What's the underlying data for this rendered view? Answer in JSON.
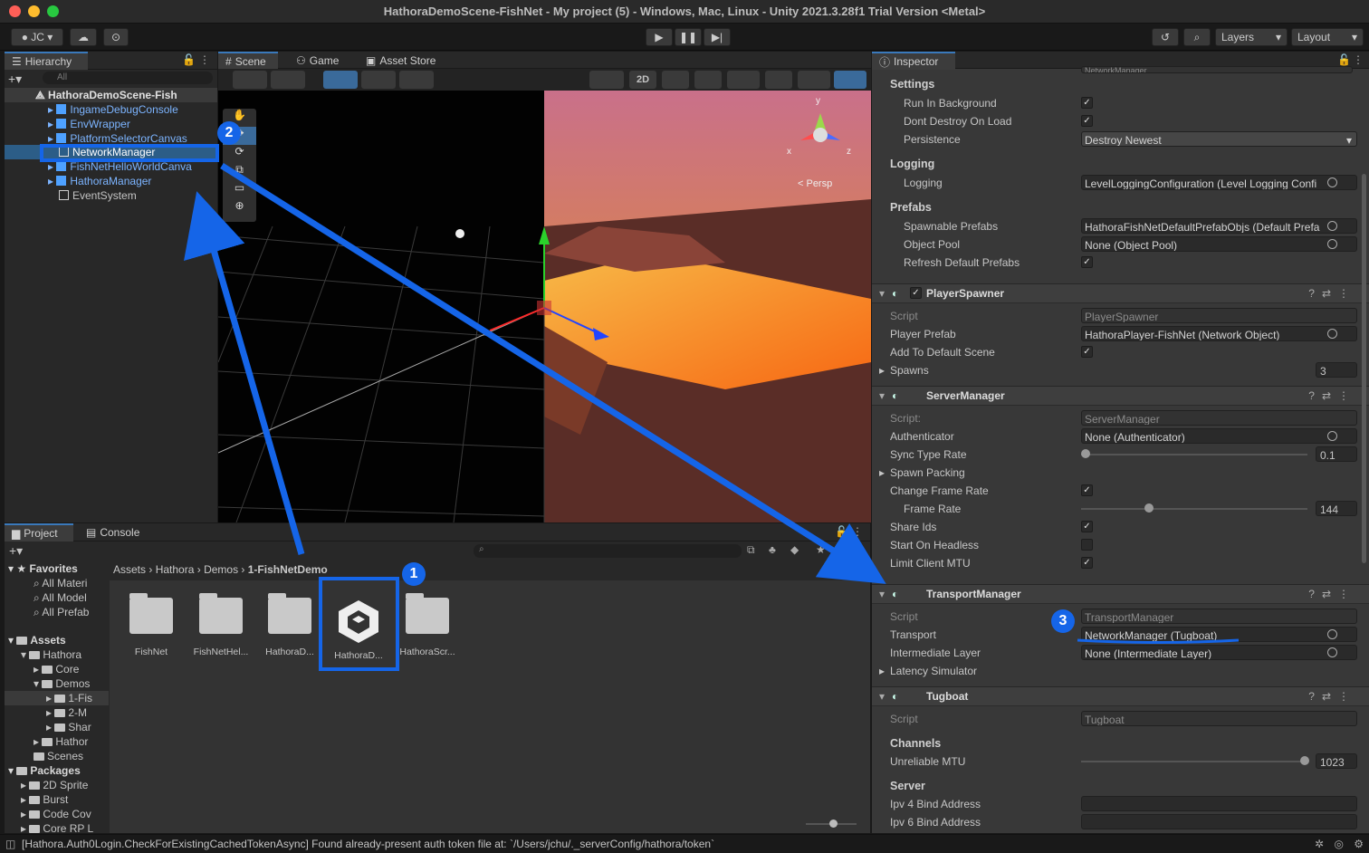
{
  "window": {
    "title": "HathoraDemoScene-FishNet - My project (5) - Windows, Mac, Linux - Unity 2021.3.28f1 Trial Version <Metal>"
  },
  "toolbar": {
    "account": "JC",
    "layers": "Layers",
    "layout": "Layout"
  },
  "hierarchy": {
    "tab": "Hierarchy",
    "search_placeholder": "All",
    "scene": "HathoraDemoScene-Fish",
    "items": [
      "IngameDebugConsole",
      "EnvWrapper",
      "PlatformSelectorCanvas",
      "NetworkManager",
      "FishNetHelloWorldCanva",
      "HathoraManager",
      "EventSystem"
    ]
  },
  "scene_tabs": {
    "scene": "Scene",
    "game": "Game",
    "asset_store": "Asset Store",
    "mode_2d": "2D",
    "persp": "< Persp",
    "axis_y": "y",
    "axis_x": "x",
    "axis_z": "z"
  },
  "inspector": {
    "tab": "Inspector",
    "top_script": "NetworkManager",
    "settings": {
      "header": "Settings",
      "run_in_background": "Run In Background",
      "dont_destroy": "Dont Destroy On Load",
      "persistence": "Persistence",
      "persistence_value": "Destroy Newest"
    },
    "logging": {
      "header": "Logging",
      "label": "Logging",
      "value": "LevelLoggingConfiguration (Level Logging Confi"
    },
    "prefabs": {
      "header": "Prefabs",
      "spawnable": "Spawnable Prefabs",
      "spawnable_value": "HathoraFishNetDefaultPrefabObjs (Default Prefa",
      "object_pool": "Object Pool",
      "object_pool_value": "None (Object Pool)",
      "refresh": "Refresh Default Prefabs"
    },
    "player_spawner": {
      "name": "PlayerSpawner",
      "script": "Script",
      "script_value": "PlayerSpawner",
      "player_prefab": "Player Prefab",
      "player_prefab_value": "HathoraPlayer-FishNet (Network Object)",
      "add_to_default": "Add To Default Scene",
      "spawns": "Spawns",
      "spawns_value": "3"
    },
    "server_manager": {
      "name": "ServerManager",
      "script": "Script:",
      "script_value": "ServerManager",
      "authenticator": "Authenticator",
      "authenticator_value": "None (Authenticator)",
      "sync_type_rate": "Sync Type Rate",
      "sync_type_rate_value": "0.1",
      "spawn_packing": "Spawn Packing",
      "change_frame_rate": "Change Frame Rate",
      "frame_rate": "Frame Rate",
      "frame_rate_value": "144",
      "share_ids": "Share Ids",
      "start_headless": "Start On Headless",
      "limit_mtu": "Limit Client MTU"
    },
    "transport_manager": {
      "name": "TransportManager",
      "script": "Script",
      "script_value": "TransportManager",
      "transport": "Transport",
      "transport_value": "NetworkManager (Tugboat)",
      "intermediate": "Intermediate Layer",
      "intermediate_value": "None (Intermediate Layer)",
      "latency": "Latency Simulator"
    },
    "tugboat": {
      "name": "Tugboat",
      "script": "Script",
      "script_value": "Tugboat",
      "channels": "Channels",
      "unreliable_mtu": "Unreliable MTU",
      "unreliable_mtu_value": "1023",
      "server": "Server",
      "ipv4": "Ipv 4 Bind Address",
      "ipv6": "Ipv 6 Bind Address"
    }
  },
  "project": {
    "tab_project": "Project",
    "tab_console": "Console",
    "breadcrumb": [
      "Assets",
      "Hathora",
      "Demos",
      "1-FishNetDemo"
    ],
    "tree": [
      "Favorites",
      "All Materi",
      "All Model",
      "All Prefab",
      "Assets",
      "Hathora",
      "Core",
      "Demos",
      "1-Fis",
      "2-M",
      "Shar",
      "Hathor",
      "Scenes",
      "Packages",
      "2D Sprite",
      "Burst",
      "Code Cov",
      "Core RP L"
    ],
    "assets": [
      "FishNet",
      "FishNetHel...",
      "HathoraD...",
      "HathoraD...",
      "HathoraScr..."
    ]
  },
  "status": {
    "message": "[Hathora.Auth0Login.CheckForExistingCachedTokenAsync] Found already-present auth token file at: `/Users/jchu/._serverConfig/hathora/token`"
  },
  "annotations": [
    "1",
    "2",
    "3"
  ],
  "colors": {
    "accent": "#1565e8",
    "selection": "#2c5d87",
    "unity_blue": "#3a79bb"
  }
}
